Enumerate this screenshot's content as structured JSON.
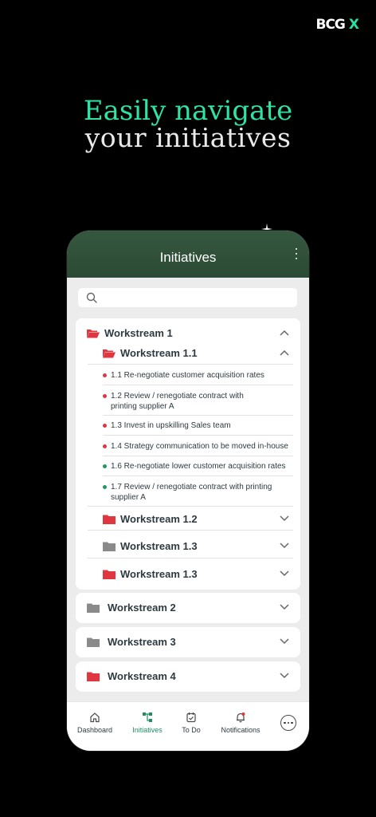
{
  "brand": {
    "text": "BCG",
    "x": "X"
  },
  "headline": {
    "line1": "Easily navigate",
    "line2": "your initiatives"
  },
  "app": {
    "title": "Initiatives",
    "workstream1": {
      "label": "Workstream 1",
      "sub": {
        "label": "Workstream 1.1",
        "items": [
          {
            "text": "1.1 Re-negotiate customer acquisition rates",
            "status": "red"
          },
          {
            "text": "1.2 Review / renegotiate contract with printing supplier A",
            "status": "red"
          },
          {
            "text": "1.3 Invest in upskilling Sales team",
            "status": "red"
          },
          {
            "text": "1.4 Strategy communication to be moved in-house",
            "status": "red"
          },
          {
            "text": "1.6 Re-negotiate lower customer acquisition rates",
            "status": "green"
          },
          {
            "text": "1.7 Review / renegotiate contract with printing supplier A",
            "status": "green"
          }
        ]
      },
      "subs_collapsed": [
        {
          "label": "Workstream 1.2",
          "folder": "red"
        },
        {
          "label": "Workstream 1.3",
          "folder": "gray"
        },
        {
          "label": "Workstream 1.3",
          "folder": "red"
        }
      ]
    },
    "workstreams": [
      {
        "label": "Workstream 2",
        "folder": "gray"
      },
      {
        "label": "Workstream 3",
        "folder": "gray"
      },
      {
        "label": "Workstream 4",
        "folder": "red"
      }
    ],
    "nav": [
      {
        "label": "Dashboard",
        "icon": "home-icon",
        "active": false
      },
      {
        "label": "Initiatives",
        "icon": "initiatives-icon",
        "active": true
      },
      {
        "label": "To Do",
        "icon": "todo-icon",
        "active": false
      },
      {
        "label": "Notifications",
        "icon": "bell-icon",
        "active": false
      }
    ]
  },
  "colors": {
    "accent": "#2ee3a6",
    "appbar": "#2f4e39",
    "folder_red": "#e0363f",
    "folder_gray": "#8a8a8a",
    "dot_red": "#e0363f",
    "dot_green": "#1e9a5e",
    "nav_active": "#1e8f63"
  }
}
